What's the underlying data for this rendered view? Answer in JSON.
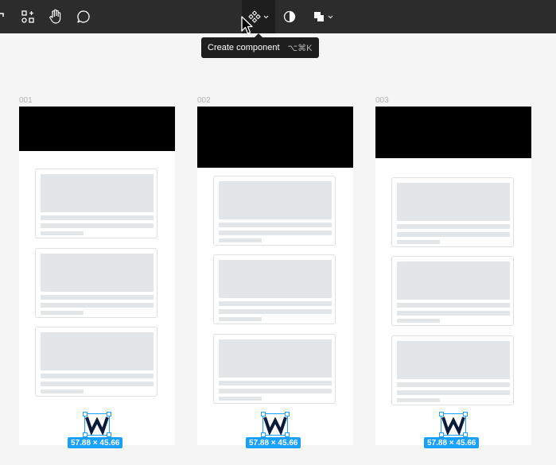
{
  "toolbar": {
    "tools": [
      {
        "icon": "frame-icon"
      },
      {
        "icon": "resources-icon"
      },
      {
        "icon": "hand-icon"
      },
      {
        "icon": "comment-icon"
      }
    ],
    "center": [
      {
        "icon": "component-icon",
        "active": true
      },
      {
        "icon": "mask-icon"
      },
      {
        "icon": "boolean-union-icon"
      }
    ]
  },
  "tooltip": {
    "label": "Create component",
    "shortcut": "⌥⌘K"
  },
  "frames": [
    {
      "label": "001",
      "size_badge": "57.88 × 45.66"
    },
    {
      "label": "002",
      "size_badge": "57.88 × 45.66"
    },
    {
      "label": "003",
      "size_badge": "57.88 × 45.66"
    }
  ],
  "colors": {
    "toolbar_bg": "#2c2c2c",
    "canvas_bg": "#f5f5f5",
    "selection_blue": "#18a0fb",
    "placeholder_gray": "#e2e6e9"
  }
}
